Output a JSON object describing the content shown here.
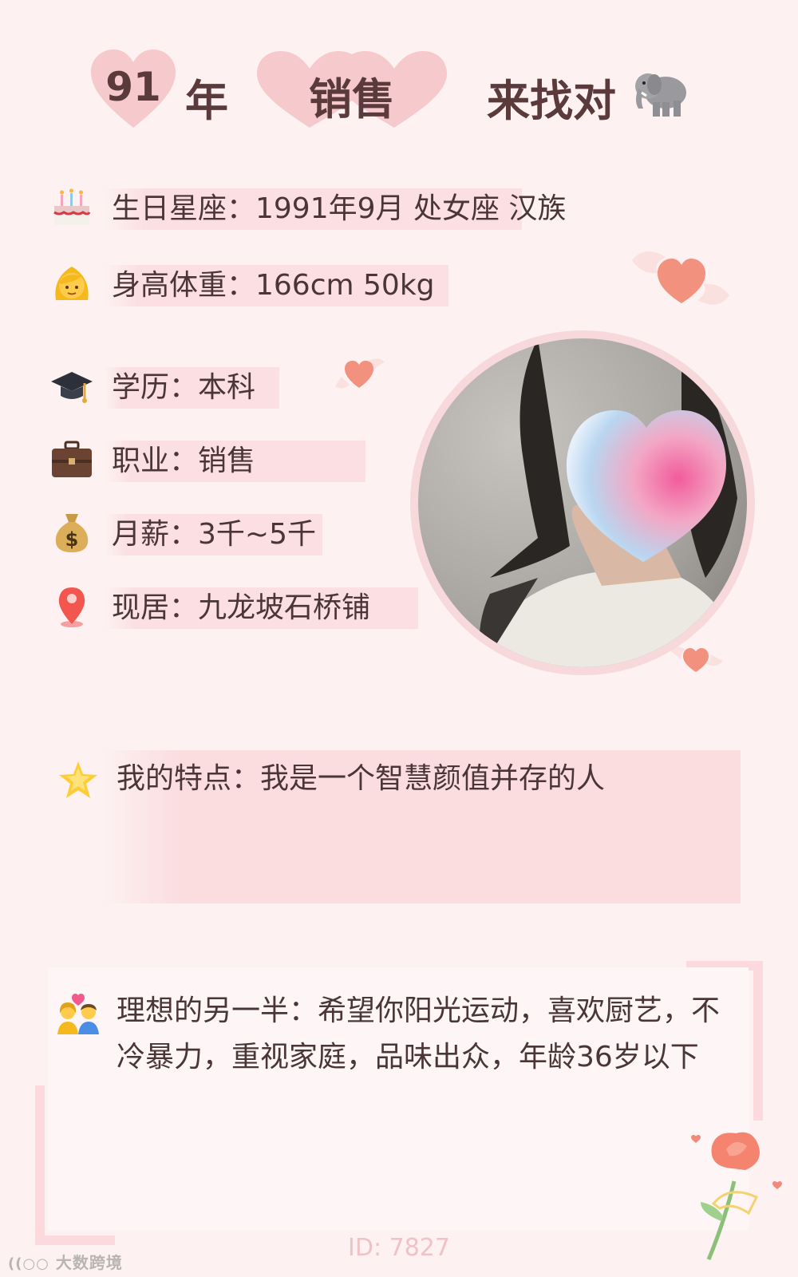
{
  "header": {
    "year": "91",
    "year_suffix": "年",
    "job": "销售",
    "tagline": "来找对",
    "tagline_icon": "elephant-icon"
  },
  "info": [
    {
      "icon": "birthday-cake-icon",
      "text": "生日星座：1991年9月 处女座 汉族"
    },
    {
      "icon": "woman-face-icon",
      "text": "身高体重：166cm 50kg"
    },
    {
      "icon": "graduation-cap-icon",
      "text": "学历：本科"
    },
    {
      "icon": "briefcase-icon",
      "text": "职业：销售"
    },
    {
      "icon": "money-bag-icon",
      "text": "月薪：3千~5千"
    },
    {
      "icon": "location-pin-icon",
      "text": "现居：九龙坡石桥铺"
    }
  ],
  "feature": {
    "icon": "star-icon",
    "text": "我的特点：我是一个智慧颜值并存的人"
  },
  "ideal": {
    "icon": "couple-icon",
    "text": "理想的另一半：希望你阳光运动，喜欢厨艺，不冷暴力，重视家庭，品味出众，年龄36岁以下"
  },
  "footer": {
    "id": "ID: 7827",
    "watermark": "大数跨境"
  },
  "colors": {
    "background": "#fdf1f1",
    "highlight": "#fbdfe2",
    "heart": "#f6c9cc",
    "accent": "#f28a7a"
  }
}
